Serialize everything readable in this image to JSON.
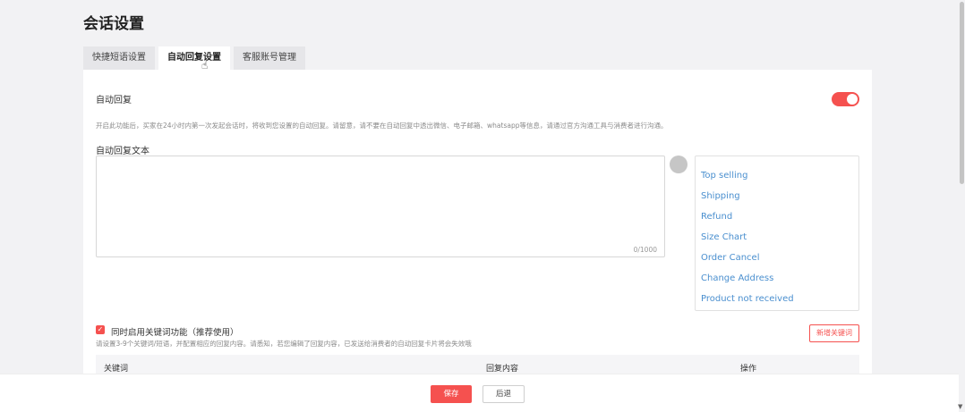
{
  "page": {
    "title": "会话设置"
  },
  "tabs": [
    {
      "label": "快捷短语设置",
      "active": false
    },
    {
      "label": "自动回复设置",
      "active": true
    },
    {
      "label": "客服账号管理",
      "active": false
    }
  ],
  "auto_reply": {
    "label": "自动回复",
    "enabled": true,
    "hint": "开启此功能后，买家在24小时内第一次发起会话时，将收到您设置的自动回复。请留意，请不要在自动回复中透出微信、电子邮箱、whatsapp等信息，请通过官方沟通工具与消费者进行沟通。",
    "text_label": "自动回复文本",
    "text_value": "",
    "counter": "0/1000"
  },
  "quick_phrases": [
    "Top selling",
    "Shipping",
    "Refund",
    "Size Chart",
    "Order Cancel",
    "Change Address",
    "Product not received"
  ],
  "keywords": {
    "enable_label": "同时启用关键词功能（推荐使用）",
    "checked": true,
    "hint": "请设置3-9个关键词/短语，并配置相应的回复内容。请悉知，若您编辑了回复内容，已发送给消费者的自动回复卡片将会失效哦",
    "add_button": "新增关键词",
    "columns": [
      "关键词",
      "回复内容",
      "操作"
    ]
  },
  "footer": {
    "save_label": "保存",
    "back_label": "后退"
  },
  "colors": {
    "accent": "#f5514f",
    "link": "#4a8fcf"
  }
}
